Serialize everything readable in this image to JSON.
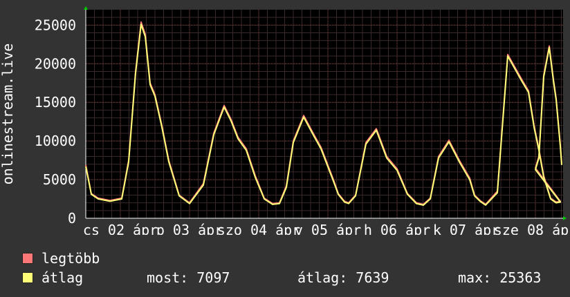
{
  "chart_data": {
    "type": "line",
    "ylabel": "onlinestream.live",
    "yticks": [
      0,
      5000,
      10000,
      15000,
      20000,
      25000
    ],
    "ylim": [
      0,
      27000
    ],
    "grid": true,
    "xtick_labels": [
      "cs 02 ápr",
      "p 03 ápr",
      "szo 04 ápr",
      "v 05 ápr",
      "h 06 ápr",
      "k 07 ápr",
      "sze 08 ápr"
    ],
    "x_range": [
      0,
      6.9
    ],
    "series": [
      {
        "name": "legtöbb",
        "color": "#ff7777",
        "x": [
          0.0,
          0.08,
          0.18,
          0.35,
          0.52,
          0.62,
          0.72,
          0.8,
          0.86,
          0.93,
          1.0,
          1.1,
          1.2,
          1.35,
          1.5,
          1.7,
          1.85,
          2.0,
          2.1,
          2.2,
          2.32,
          2.45,
          2.58,
          2.7,
          2.8,
          2.9,
          3.0,
          3.15,
          3.3,
          3.4,
          3.58,
          3.65,
          3.74,
          3.8,
          3.9,
          4.05,
          4.2,
          4.35,
          4.5,
          4.65,
          4.78,
          4.88,
          4.98,
          5.1,
          5.25,
          5.4,
          5.55,
          5.62,
          5.7,
          5.78,
          5.95,
          6.1,
          6.3,
          6.4,
          6.48,
          6.55,
          6.62,
          6.72,
          6.8,
          6.86
        ],
        "y": [
          6900,
          3200,
          2600,
          2300,
          2600,
          7500,
          19000,
          25400,
          23800,
          17500,
          16000,
          12000,
          7500,
          3000,
          2000,
          4500,
          11000,
          14600,
          12800,
          10500,
          9000,
          5500,
          2600,
          1900,
          2000,
          4200,
          10000,
          13300,
          10800,
          9200,
          5000,
          3200,
          2200,
          2000,
          3000,
          9800,
          11600,
          8000,
          6400,
          3200,
          2000,
          1800,
          2600,
          8000,
          10100,
          7500,
          5200,
          3000,
          2300,
          1800,
          3500,
          21200,
          18000,
          16500,
          12000,
          9000,
          5500,
          2600,
          2100,
          2200
        ],
        "y_tail": [
          6500,
          8000,
          18500,
          22300,
          18000,
          15500,
          9500,
          7100
        ],
        "x_tail": [
          6.5,
          6.55,
          6.62,
          6.7,
          6.76,
          6.8,
          6.86,
          6.88
        ]
      },
      {
        "name": "átlag",
        "color": "#ffff77",
        "x": [
          0.0,
          0.08,
          0.18,
          0.35,
          0.52,
          0.62,
          0.72,
          0.8,
          0.86,
          0.93,
          1.0,
          1.1,
          1.2,
          1.35,
          1.5,
          1.7,
          1.85,
          2.0,
          2.1,
          2.2,
          2.32,
          2.45,
          2.58,
          2.7,
          2.8,
          2.9,
          3.0,
          3.15,
          3.3,
          3.4,
          3.58,
          3.65,
          3.74,
          3.8,
          3.9,
          4.05,
          4.2,
          4.35,
          4.5,
          4.65,
          4.78,
          4.88,
          4.98,
          5.1,
          5.25,
          5.4,
          5.55,
          5.62,
          5.7,
          5.78,
          5.95,
          6.1,
          6.3,
          6.4,
          6.48,
          6.55,
          6.62,
          6.72,
          6.8,
          6.86
        ],
        "y": [
          6700,
          3100,
          2500,
          2200,
          2500,
          7300,
          18800,
          25100,
          23500,
          17300,
          15800,
          11800,
          7300,
          2900,
          1900,
          4300,
          10800,
          14400,
          12600,
          10300,
          8800,
          5300,
          2500,
          1800,
          1900,
          4000,
          9800,
          13100,
          10600,
          9000,
          4800,
          3100,
          2100,
          1900,
          2900,
          9600,
          11400,
          7800,
          6200,
          3100,
          1900,
          1700,
          2500,
          7800,
          9900,
          7300,
          5000,
          2900,
          2200,
          1700,
          3300,
          21000,
          17800,
          16300,
          11800,
          8800,
          5300,
          2500,
          2000,
          2100
        ],
        "y_tail": [
          6300,
          7800,
          18300,
          22100,
          17800,
          15300,
          9300,
          6900
        ],
        "x_tail": [
          6.5,
          6.55,
          6.62,
          6.7,
          6.76,
          6.8,
          6.86,
          6.88
        ]
      }
    ]
  },
  "legend": {
    "items": [
      {
        "label": "legtöbb",
        "color": "#ff7777"
      },
      {
        "label": "átlag",
        "color": "#ffff77"
      }
    ],
    "stats": {
      "most": "most: 7097",
      "atlag": "átlag: 7639",
      "max": "max: 25363"
    }
  }
}
